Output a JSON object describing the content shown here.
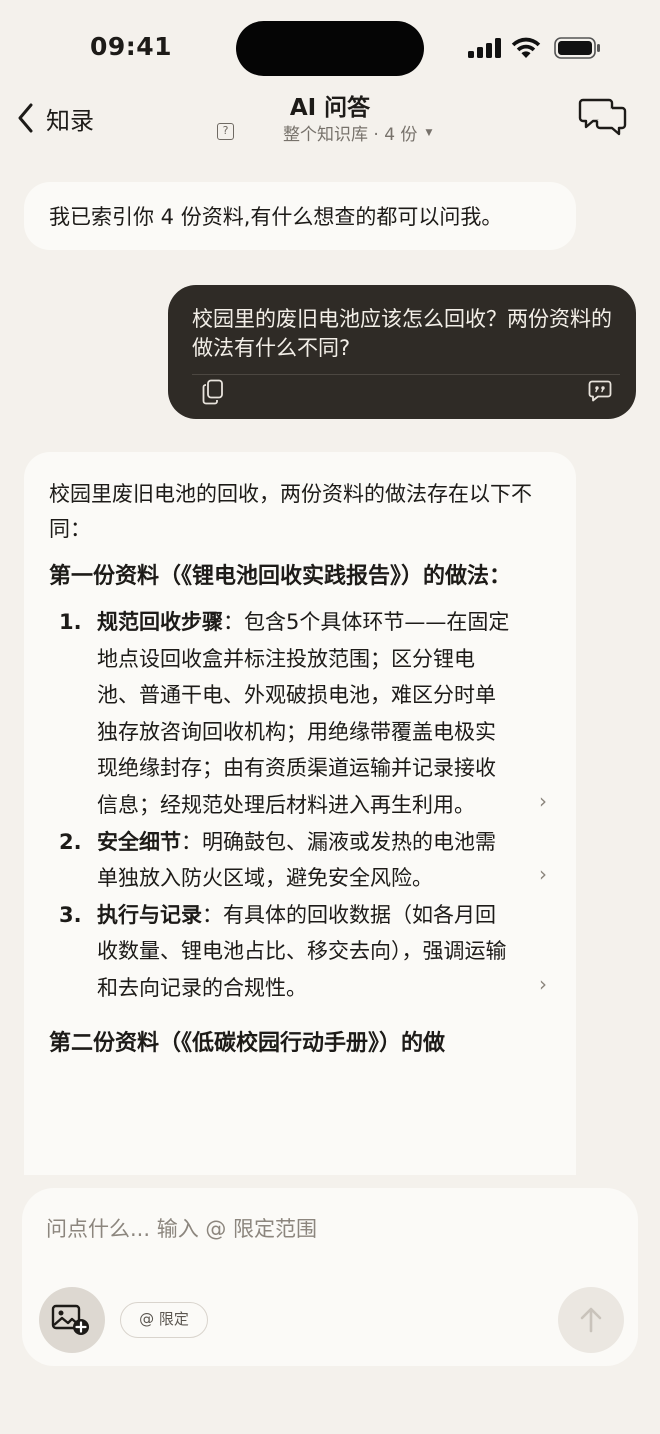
{
  "status_bar": {
    "time": "09:41"
  },
  "nav": {
    "back_label": "知录",
    "title": "AI 问答",
    "help_glyph": "?",
    "scope_label": "整个知识库 · 4 份",
    "scope_caret": "▼"
  },
  "messages": {
    "bot_greeting": "我已索引你 4 份资料,有什么想查的都可以问我。",
    "user_question": "校园里的废旧电池应该怎么回收？两份资料的做法有什么不同?",
    "answer": {
      "intro": "校园里废旧电池的回收，两份资料的做法存在以下不同：",
      "section1_heading": "第一份资料（《锂电池回收实践报告》）的做法：",
      "items": [
        {
          "num": "1.",
          "title": "规范回收步骤",
          "text": "：包含5个具体环节——在固定地点设回收盒并标注投放范围；区分锂电池、普通干电、外观破损电池，难区分时单独存放咨询回收机构；用绝缘带覆盖电极实现绝缘封存；由有资质渠道运输并记录接收信息；经规范处理后材料进入再生利用。"
        },
        {
          "num": "2.",
          "title": "安全细节",
          "text": "：明确鼓包、漏液或发热的电池需单独放入防火区域，避免安全风险。"
        },
        {
          "num": "3.",
          "title": "执行与记录",
          "text": "：有具体的回收数据（如各月回收数量、锂电池占比、移交去向），强调运输和去向记录的合规性。"
        }
      ],
      "section2_heading": "第二份资料（《低碳校园行动手册》）的做",
      "chevron": "›"
    }
  },
  "composer": {
    "placeholder": "问点什么... 输入 @ 限定范围",
    "scope_chip": "@ 限定"
  },
  "icons": {
    "back": "chevron-left-icon",
    "chat": "chat-bubbles-icon",
    "copy": "copy-icon",
    "quote": "quote-icon",
    "image": "image-add-icon",
    "send": "arrow-up-icon"
  },
  "colors": {
    "background": "#f4f1ec",
    "bubble_light": "#fbfaf7",
    "bubble_dark": "#2f2b26",
    "text": "#1d1b18",
    "muted": "#77726b"
  }
}
